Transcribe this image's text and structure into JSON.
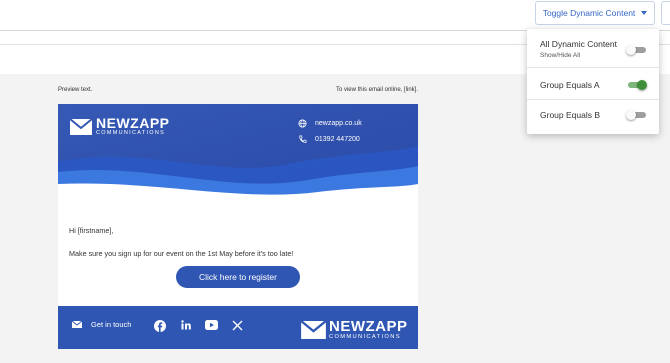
{
  "toolbar": {
    "toggle_label": "Toggle Dynamic Content"
  },
  "email": {
    "preview_text": "Preview text.",
    "view_online": "To view this email online, [link].",
    "logo_name": "NEWZAPP",
    "logo_sub": "COMMUNICATIONS",
    "website": "newzapp.co.uk",
    "phone": "01392 447200",
    "greeting": "Hi [firstname],",
    "message": "Make sure you sign up for our event on the 1st May before it's too late!",
    "cta": "Click here to register",
    "footer_contact": "Get in touch"
  },
  "dropdown": {
    "items": [
      {
        "label": "All Dynamic Content",
        "sublabel": "Show/Hide All",
        "state": "off"
      },
      {
        "label": "Group Equals A",
        "state": "on"
      },
      {
        "label": "Group Equals B",
        "state": "off"
      }
    ]
  },
  "colors": {
    "brand_blue": "#2f56b3",
    "switch_on": "#3e8e3a",
    "link_blue": "#3567c5"
  }
}
